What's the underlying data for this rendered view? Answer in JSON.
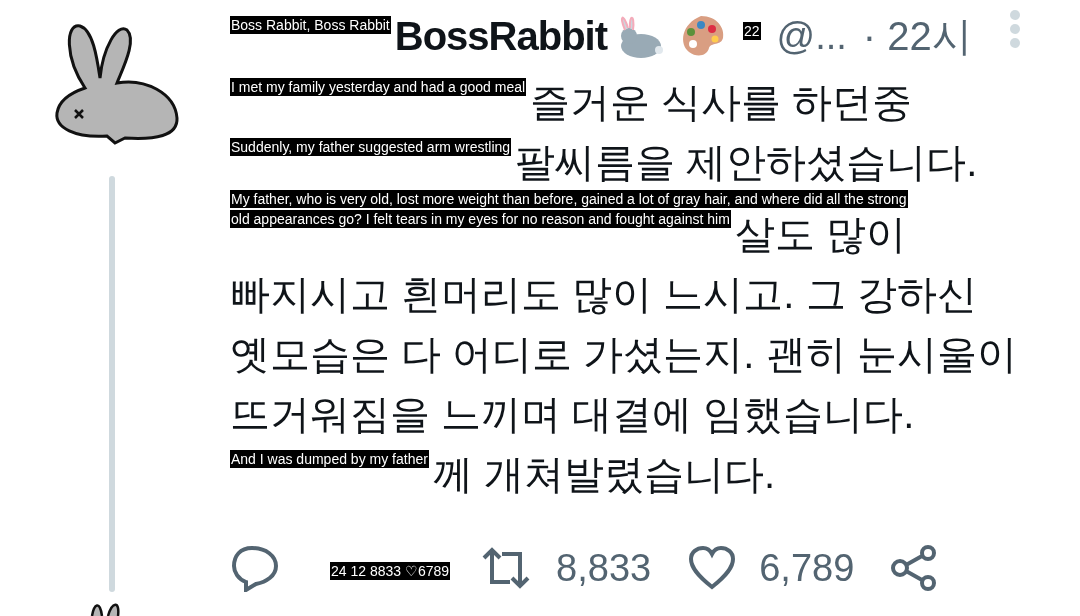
{
  "header": {
    "caption": "Boss Rabbit, Boss Rabbit",
    "display_name": "BossRabbit",
    "handle_caption": "22",
    "handle": "@...",
    "time": "· 22시"
  },
  "lines": [
    {
      "caption": "I met my family yesterday and had a good meal",
      "text": "즐거운 식사를 하던중"
    },
    {
      "caption": "Suddenly, my father suggested arm wrestling",
      "text": "팔씨름을 제안하셨습니다."
    },
    {
      "caption": "My father, who is very old, lost more weight than before, gained a lot of gray hair, and where did all the strong"
    },
    {
      "caption": "old appearances go? I felt tears in my eyes for no reason and fought against him",
      "text": "살도 많이"
    },
    {
      "text": "빠지시고 흰머리도 많이 느시고. 그 강하신"
    },
    {
      "text": "옛모습은 다 어디로 가셨는지. 괜히 눈시울이"
    },
    {
      "text": "뜨거워짐을 느끼며 대결에 임했습니다."
    },
    {
      "caption": "And I was dumped by my father",
      "text": "께 개쳐발렸습니다."
    }
  ],
  "actions": [
    {
      "kind": "reply",
      "caption": "24 12 8833 ♡6789"
    },
    {
      "kind": "retweet",
      "count": "8,833"
    },
    {
      "kind": "like",
      "count": "6,789"
    },
    {
      "kind": "share"
    }
  ]
}
